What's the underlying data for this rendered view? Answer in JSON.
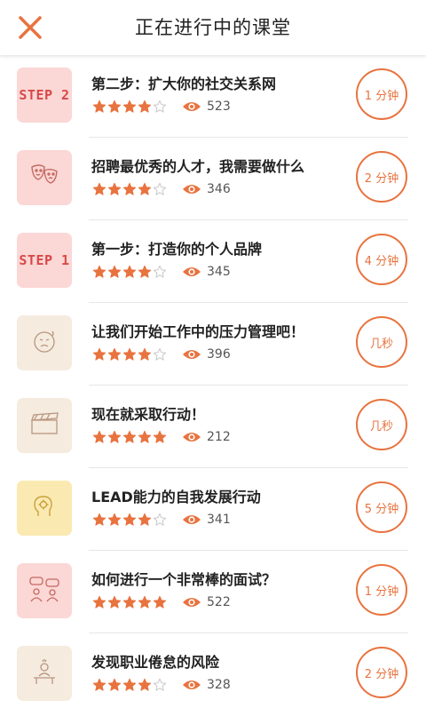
{
  "header": {
    "title": "正在进行中的课堂",
    "close_icon": "close-icon"
  },
  "colors": {
    "accent": "#e8733f",
    "star": "#e8733f",
    "star_empty": "#c8c8c8"
  },
  "lessons": [
    {
      "title": "第二步：扩大你的社交关系网",
      "rating": 4,
      "views": "523",
      "duration": "1 分钟",
      "thumb_label": "STEP 2",
      "thumb_icon": "step-2-badge",
      "thumb_bg": "#fbd7d5"
    },
    {
      "title": "招聘最优秀的人才，我需要做什么",
      "rating": 4,
      "views": "346",
      "duration": "2 分钟",
      "thumb_label": "",
      "thumb_icon": "theater-masks-icon",
      "thumb_bg": "#fbd7d5"
    },
    {
      "title": "第一步：打造你的个人品牌",
      "rating": 4,
      "views": "345",
      "duration": "4 分钟",
      "thumb_label": "STEP 1",
      "thumb_icon": "step-1-badge",
      "thumb_bg": "#fbd7d5"
    },
    {
      "title": "让我们开始工作中的压力管理吧！",
      "rating": 4,
      "views": "396",
      "duration": "几秒",
      "thumb_label": "",
      "thumb_icon": "stressed-face-icon",
      "thumb_bg": "#f5ebdf"
    },
    {
      "title": "现在就采取行动！",
      "rating": 5,
      "views": "212",
      "duration": "几秒",
      "thumb_label": "",
      "thumb_icon": "clapperboard-icon",
      "thumb_bg": "#f5ebdf"
    },
    {
      "title": "LEAD能力的自我发展行动",
      "rating": 4,
      "views": "341",
      "duration": "5 分钟",
      "thumb_label": "",
      "thumb_icon": "head-gear-icon",
      "thumb_bg": "#fbe9b2"
    },
    {
      "title": "如何进行一个非常棒的面试？",
      "rating": 5,
      "views": "522",
      "duration": "1 分钟",
      "thumb_label": "",
      "thumb_icon": "interview-chat-icon",
      "thumb_bg": "#fbd7d5"
    },
    {
      "title": "发现职业倦怠的风险",
      "rating": 4,
      "views": "328",
      "duration": "2 分钟",
      "thumb_label": "",
      "thumb_icon": "burnout-desk-icon",
      "thumb_bg": "#f5ebdf"
    }
  ]
}
